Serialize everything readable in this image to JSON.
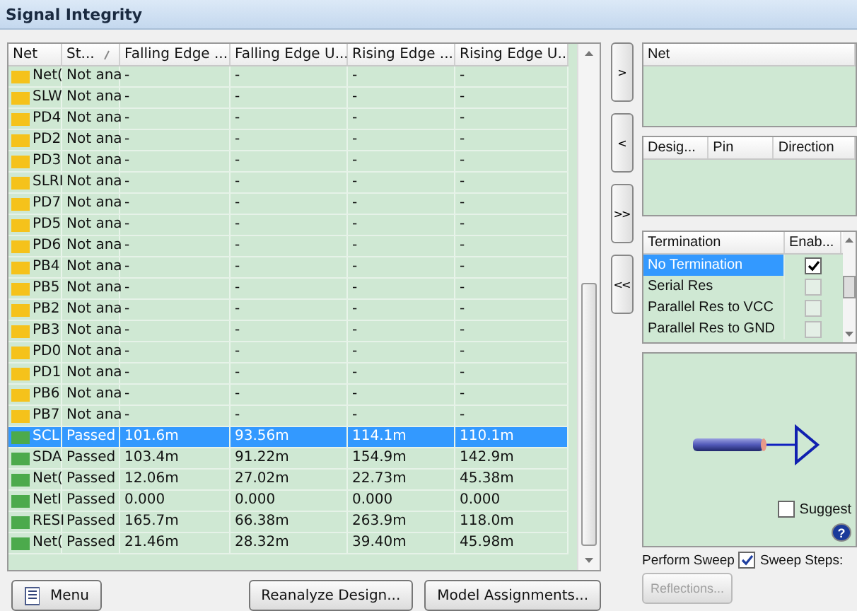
{
  "window": {
    "title": "Signal Integrity"
  },
  "table": {
    "columns": [
      "Net",
      "St...",
      "Falling Edge ...",
      "Falling Edge U...",
      "Rising Edge ...",
      "Rising Edge U..."
    ],
    "rows": [
      {
        "kind": "not_analyzed",
        "selected": false,
        "cells": [
          "Net(",
          "Not ana",
          "-",
          "-",
          "-",
          "-"
        ]
      },
      {
        "kind": "not_analyzed",
        "selected": false,
        "cells": [
          "SLW",
          "Not ana",
          "-",
          "-",
          "-",
          "-"
        ]
      },
      {
        "kind": "not_analyzed",
        "selected": false,
        "cells": [
          "PD4",
          "Not ana",
          "-",
          "-",
          "-",
          "-"
        ]
      },
      {
        "kind": "not_analyzed",
        "selected": false,
        "cells": [
          "PD2",
          "Not ana",
          "-",
          "-",
          "-",
          "-"
        ]
      },
      {
        "kind": "not_analyzed",
        "selected": false,
        "cells": [
          "PD3",
          "Not ana",
          "-",
          "-",
          "-",
          "-"
        ]
      },
      {
        "kind": "not_analyzed",
        "selected": false,
        "cells": [
          "SLRI",
          "Not ana",
          "-",
          "-",
          "-",
          "-"
        ]
      },
      {
        "kind": "not_analyzed",
        "selected": false,
        "cells": [
          "PD7",
          "Not ana",
          "-",
          "-",
          "-",
          "-"
        ]
      },
      {
        "kind": "not_analyzed",
        "selected": false,
        "cells": [
          "PD5",
          "Not ana",
          "-",
          "-",
          "-",
          "-"
        ]
      },
      {
        "kind": "not_analyzed",
        "selected": false,
        "cells": [
          "PD6",
          "Not ana",
          "-",
          "-",
          "-",
          "-"
        ]
      },
      {
        "kind": "not_analyzed",
        "selected": false,
        "cells": [
          "PB4",
          "Not ana",
          "-",
          "-",
          "-",
          "-"
        ]
      },
      {
        "kind": "not_analyzed",
        "selected": false,
        "cells": [
          "PB5",
          "Not ana",
          "-",
          "-",
          "-",
          "-"
        ]
      },
      {
        "kind": "not_analyzed",
        "selected": false,
        "cells": [
          "PB2",
          "Not ana",
          "-",
          "-",
          "-",
          "-"
        ]
      },
      {
        "kind": "not_analyzed",
        "selected": false,
        "cells": [
          "PB3",
          "Not ana",
          "-",
          "-",
          "-",
          "-"
        ]
      },
      {
        "kind": "not_analyzed",
        "selected": false,
        "cells": [
          "PD0",
          "Not ana",
          "-",
          "-",
          "-",
          "-"
        ]
      },
      {
        "kind": "not_analyzed",
        "selected": false,
        "cells": [
          "PD1",
          "Not ana",
          "-",
          "-",
          "-",
          "-"
        ]
      },
      {
        "kind": "not_analyzed",
        "selected": false,
        "cells": [
          "PB6",
          "Not ana",
          "-",
          "-",
          "-",
          "-"
        ]
      },
      {
        "kind": "not_analyzed",
        "selected": false,
        "cells": [
          "PB7",
          "Not ana",
          "-",
          "-",
          "-",
          "-"
        ]
      },
      {
        "kind": "passed",
        "selected": true,
        "cells": [
          "SCL",
          "Passed",
          "101.6m",
          "93.56m",
          "114.1m",
          "110.1m"
        ]
      },
      {
        "kind": "passed",
        "selected": false,
        "cells": [
          "SDA",
          "Passed",
          "103.4m",
          "91.22m",
          "154.9m",
          "142.9m"
        ]
      },
      {
        "kind": "passed",
        "selected": false,
        "cells": [
          "Net(",
          "Passed",
          "12.06m",
          "27.02m",
          "22.73m",
          "45.38m"
        ]
      },
      {
        "kind": "passed",
        "selected": false,
        "cells": [
          "NetI",
          "Passed",
          "0.000",
          "0.000",
          "0.000",
          "0.000"
        ]
      },
      {
        "kind": "passed",
        "selected": false,
        "cells": [
          "RESI",
          "Passed",
          "165.7m",
          "66.38m",
          "263.9m",
          "118.0m"
        ]
      },
      {
        "kind": "passed",
        "selected": false,
        "cells": [
          "Net(",
          "Passed",
          "21.46m",
          "28.32m",
          "39.40m",
          "45.98m"
        ]
      }
    ]
  },
  "buttons": {
    "menu": "Menu",
    "reanalyze": "Reanalyze Design...",
    "models": "Model Assignments..."
  },
  "transfer_buttons": [
    ">",
    "<",
    ">>",
    "<<"
  ],
  "net_panel": {
    "columns": [
      "Net"
    ]
  },
  "pin_panel": {
    "columns": [
      "Desig...",
      "Pin",
      "Direction"
    ]
  },
  "termination": {
    "columns": [
      "Termination",
      "Enab..."
    ],
    "rows": [
      {
        "label": "No Termination",
        "enabled": true,
        "selected": true
      },
      {
        "label": "Serial Res",
        "enabled": false,
        "selected": false
      },
      {
        "label": "Parallel Res to VCC",
        "enabled": false,
        "selected": false
      },
      {
        "label": "Parallel Res to GND",
        "enabled": false,
        "selected": false
      }
    ]
  },
  "preview": {
    "suggest": {
      "label": "Suggest",
      "checked": false
    },
    "help": "?"
  },
  "sweep": {
    "label": "Perform Sweep",
    "checked": true,
    "steps_label": "Sweep Steps:"
  },
  "reflections_button": {
    "label": "Reflections...",
    "disabled": true
  }
}
